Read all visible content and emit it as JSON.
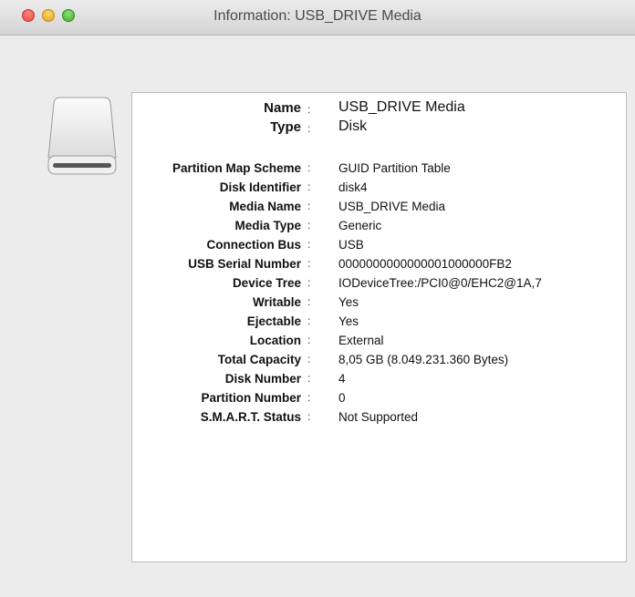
{
  "window": {
    "title": "Information: USB_DRIVE Media"
  },
  "colon": ":",
  "header": [
    {
      "label": "Name",
      "value": "USB_DRIVE Media"
    },
    {
      "label": "Type",
      "value": "Disk"
    }
  ],
  "details": [
    {
      "label": "Partition Map Scheme",
      "value": "GUID Partition Table"
    },
    {
      "label": "Disk Identifier",
      "value": "disk4"
    },
    {
      "label": "Media Name",
      "value": "USB_DRIVE Media"
    },
    {
      "label": "Media Type",
      "value": "Generic"
    },
    {
      "label": "Connection Bus",
      "value": "USB"
    },
    {
      "label": "USB Serial Number",
      "value": "0000000000000001000000FB2"
    },
    {
      "label": "Device Tree",
      "value": "IODeviceTree:/PCI0@0/EHC2@1A,7"
    },
    {
      "label": "Writable",
      "value": "Yes"
    },
    {
      "label": "Ejectable",
      "value": "Yes"
    },
    {
      "label": "Location",
      "value": "External"
    },
    {
      "label": "Total Capacity",
      "value": "8,05 GB (8.049.231.360 Bytes)"
    },
    {
      "label": "Disk Number",
      "value": "4"
    },
    {
      "label": "Partition Number",
      "value": "0"
    },
    {
      "label": "S.M.A.R.T. Status",
      "value": "Not Supported"
    }
  ]
}
